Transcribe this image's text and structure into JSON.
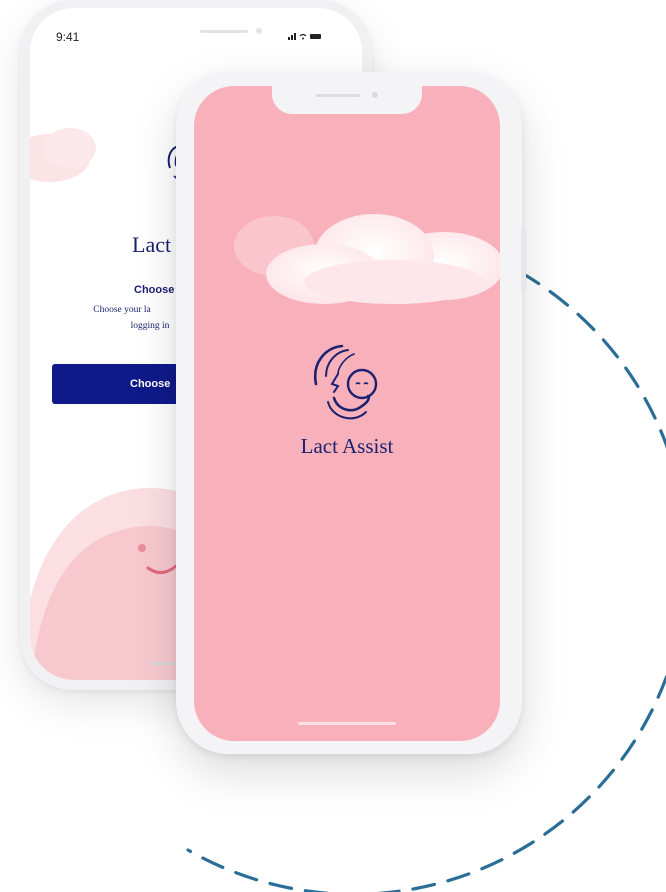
{
  "colors": {
    "accent_navy": "#0f1a8a",
    "brand_pink": "#f8b1bb",
    "arc_blue": "#2a6e98"
  },
  "back_screen": {
    "status_time": "9:41",
    "status_icons": "signal-wifi-battery-icons",
    "app_title": "Lact",
    "heading": "Choose",
    "description_line1": "Choose your la",
    "description_line2": "logging in",
    "button_label": "Choose"
  },
  "splash_screen": {
    "app_title": "Lact Assist",
    "logo_icon": "mother-baby-logo-icon"
  }
}
